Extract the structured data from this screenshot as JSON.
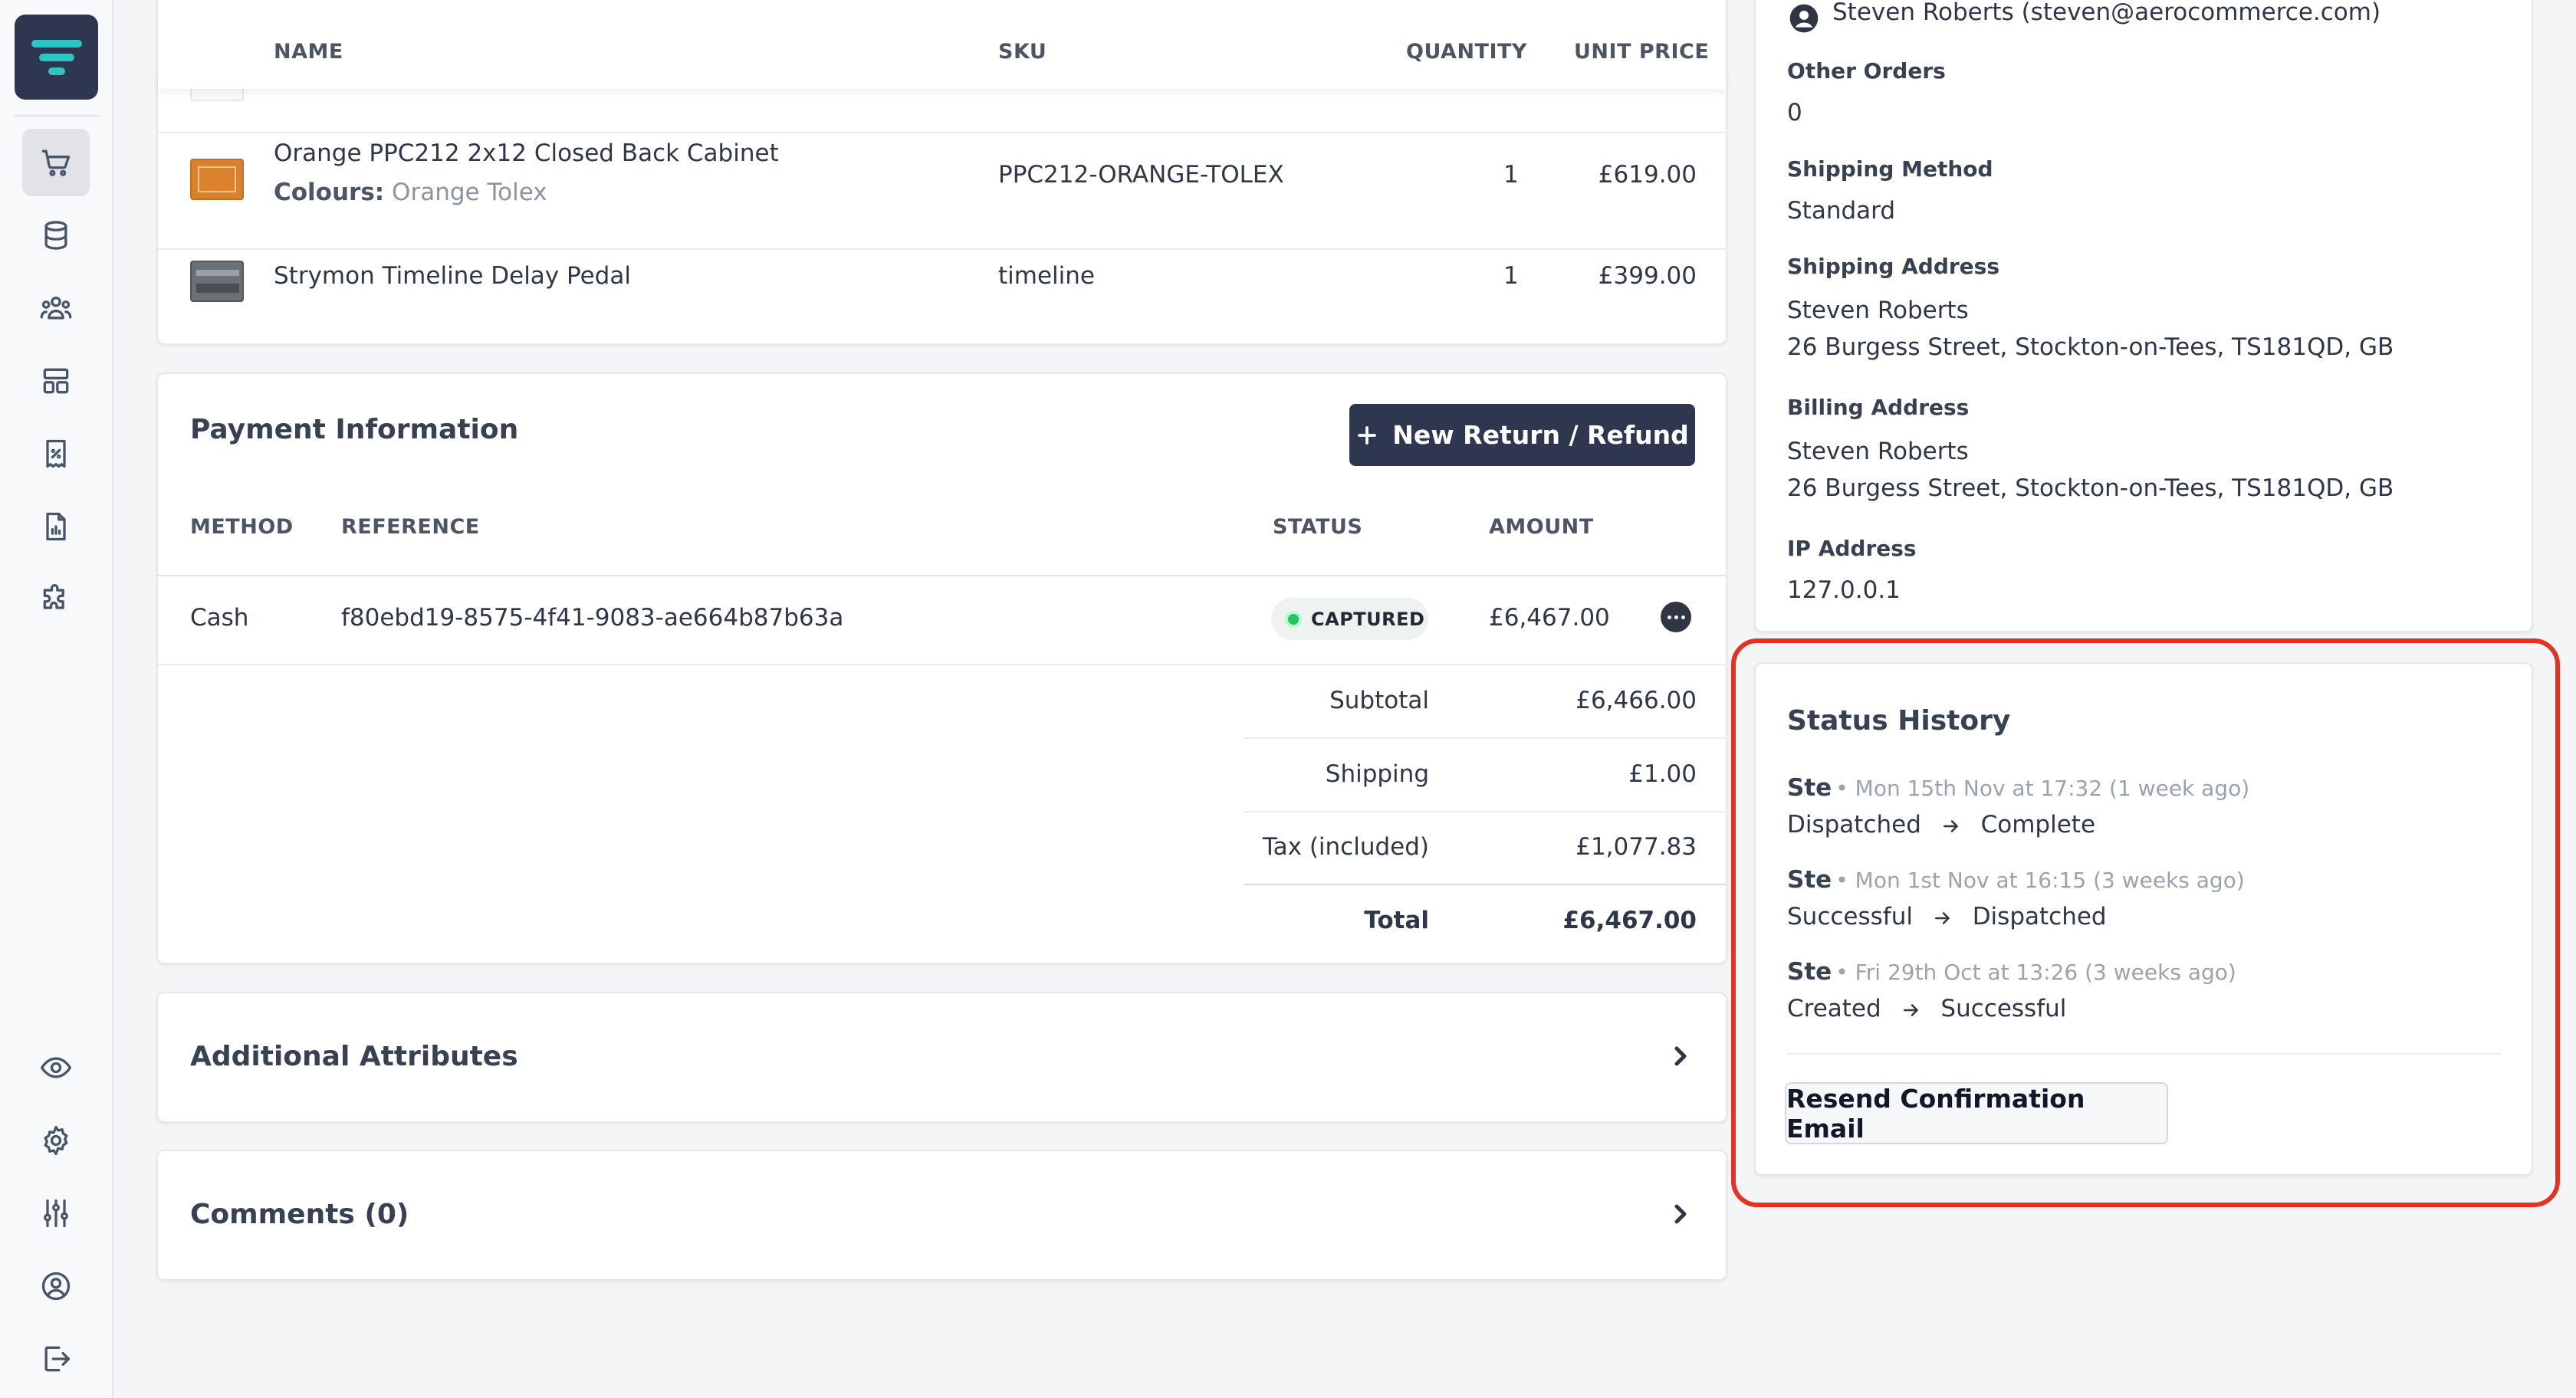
{
  "nav": {
    "items": [
      {
        "name": "orders",
        "icon": "cart-icon",
        "active": true
      },
      {
        "name": "products",
        "icon": "database-icon",
        "active": false
      },
      {
        "name": "customers",
        "icon": "users-icon",
        "active": false
      },
      {
        "name": "layout",
        "icon": "layout-icon",
        "active": false
      },
      {
        "name": "discounts",
        "icon": "receipt-percent-icon",
        "active": false
      },
      {
        "name": "reports",
        "icon": "report-chart-icon",
        "active": false
      },
      {
        "name": "extensions",
        "icon": "puzzle-icon",
        "active": false
      }
    ],
    "bottom_items": [
      {
        "name": "view-store",
        "icon": "eye-icon"
      },
      {
        "name": "settings",
        "icon": "gear-icon"
      },
      {
        "name": "config",
        "icon": "sliders-icon"
      },
      {
        "name": "account",
        "icon": "user-circle-icon"
      },
      {
        "name": "logout",
        "icon": "logout-icon"
      }
    ]
  },
  "items_table": {
    "headers": {
      "name": "NAME",
      "sku": "SKU",
      "quantity": "QUANTITY",
      "unit_price": "UNIT PRICE"
    },
    "rows": [
      {
        "name": "Orange PPC212 2x12 Closed Back Cabinet",
        "option_label": "Colours:",
        "option_value": "Orange Tolex",
        "sku": "PPC212-ORANGE-TOLEX",
        "quantity": "1",
        "price": "£619.00"
      },
      {
        "name": "Strymon Timeline Delay Pedal",
        "sku": "timeline",
        "quantity": "1",
        "price": "£399.00"
      }
    ]
  },
  "payment": {
    "title": "Payment Information",
    "new_return_label": "New Return / Refund",
    "headers": {
      "method": "METHOD",
      "reference": "REFERENCE",
      "status": "STATUS",
      "amount": "AMOUNT"
    },
    "row": {
      "method": "Cash",
      "reference": "f80ebd19-8575-4f41-9083-ae664b87b63a",
      "status": "CAPTURED",
      "amount": "£6,467.00"
    },
    "totals": [
      {
        "label": "Subtotal",
        "value": "£6,466.00"
      },
      {
        "label": "Shipping",
        "value": "£1.00"
      },
      {
        "label": "Tax (included)",
        "value": "£1,077.83"
      },
      {
        "label": "Total",
        "value": "£6,467.00"
      }
    ]
  },
  "additional_attributes": {
    "title": "Additional Attributes"
  },
  "comments": {
    "title": "Comments (0)"
  },
  "customer": {
    "name_email": "Steven Roberts (steven@aerocommerce.com)",
    "other_orders_label": "Other Orders",
    "other_orders": "0",
    "shipping_method_label": "Shipping Method",
    "shipping_method": "Standard",
    "shipping_address_label": "Shipping Address",
    "shipping_address_name": "Steven Roberts",
    "shipping_address_line": "26 Burgess Street, Stockton-on-Tees, TS181QD, GB",
    "billing_address_label": "Billing Address",
    "billing_address_name": "Steven Roberts",
    "billing_address_line": "26 Burgess Street, Stockton-on-Tees, TS181QD, GB",
    "ip_label": "IP Address",
    "ip": "127.0.0.1"
  },
  "status_history": {
    "title": "Status History",
    "entries": [
      {
        "user": "Ste",
        "meta": "• Mon 15th Nov at 17:32 (1 week ago)",
        "from": "Dispatched",
        "to": "Complete"
      },
      {
        "user": "Ste",
        "meta": "• Mon 1st Nov at 16:15 (3 weeks ago)",
        "from": "Successful",
        "to": "Dispatched"
      },
      {
        "user": "Ste",
        "meta": "• Fri 29th Oct at 13:26 (3 weeks ago)",
        "from": "Created",
        "to": "Successful"
      }
    ],
    "resend_label": "Resend Confirmation Email"
  },
  "colors": {
    "brand": "#2f3650",
    "accent_logo": "#2ec4c6",
    "highlight": "#e53323",
    "captured": "#22c55e"
  }
}
